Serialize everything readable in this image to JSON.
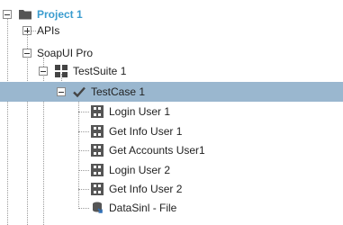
{
  "tree": {
    "project": {
      "label": "Project 1",
      "icon": "folder-icon"
    },
    "apis": {
      "label": "APIs"
    },
    "soapui_pro": {
      "label": "SoapUI Pro"
    },
    "testsuite": {
      "label": "TestSuite 1",
      "icon": "testsuite-grid-icon"
    },
    "testcase": {
      "label": "TestCase 1",
      "icon": "checkmark-icon",
      "selected": true
    },
    "steps": [
      {
        "label": "Login User 1",
        "icon": "test-step-icon"
      },
      {
        "label": "Get Info User 1",
        "icon": "test-step-icon"
      },
      {
        "label": "Get Accounts User1",
        "icon": "test-step-icon"
      },
      {
        "label": "Login User 2",
        "icon": "test-step-icon"
      },
      {
        "label": "Get Info User 2",
        "icon": "test-step-icon"
      },
      {
        "label": "DataSinl - File",
        "icon": "datasink-icon"
      }
    ]
  },
  "colors": {
    "selection": "#9ab7cf",
    "project_text": "#3a9ccf"
  }
}
